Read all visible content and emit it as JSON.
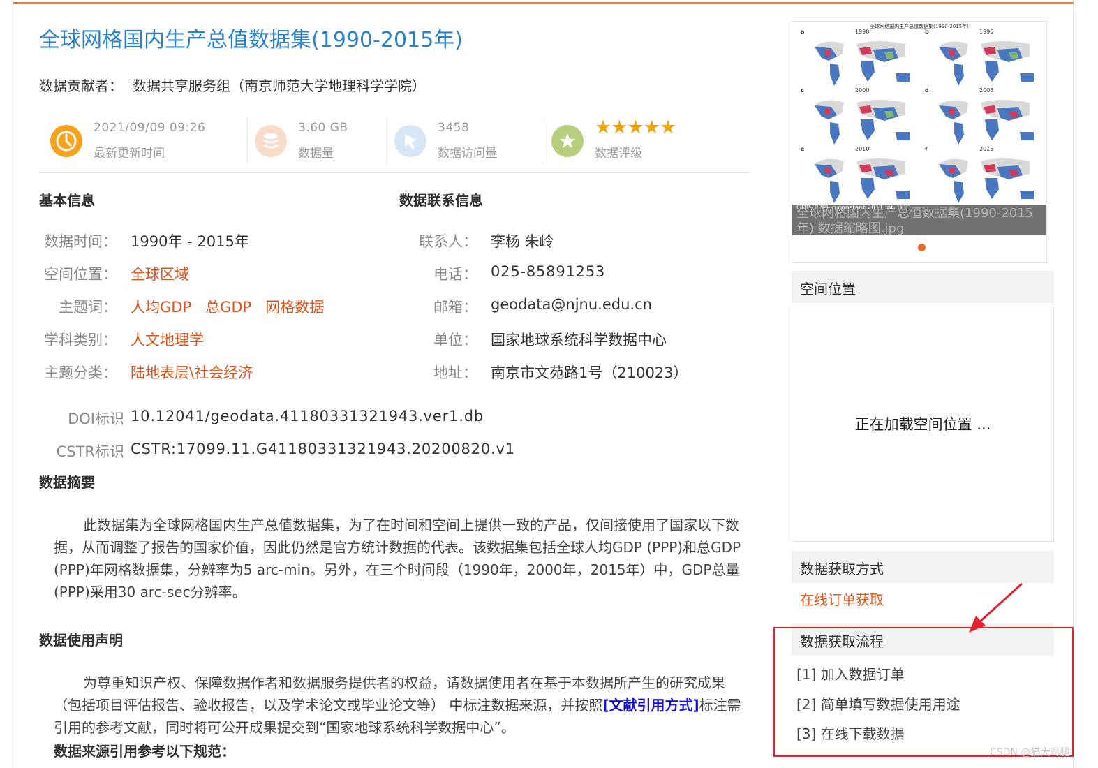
{
  "page": {
    "title": "全球网格国内生产总值数据集(1990-2015年)",
    "contributor_label": "数据贡献者：",
    "contributor_value": "数据共享服务组（南京师范大学地理科学学院）"
  },
  "stats": [
    {
      "value": "2021/09/09 09:26",
      "label": "最新更新时间",
      "icon": "clock-icon"
    },
    {
      "value": "3.60 GB",
      "label": "数据量",
      "icon": "database-icon"
    },
    {
      "value": "3458",
      "label": "数据访问量",
      "icon": "cursor-icon"
    },
    {
      "value": "★★★★★",
      "label": "数据评级",
      "icon": "star-badge-icon",
      "rating": 5
    }
  ],
  "basic_info": {
    "heading": "基本信息",
    "time_label": "数据时间：",
    "time_value": "1990年 - 2015年",
    "space_label": "空间位置：",
    "space_value": "全球区域",
    "keywords_label": "主题词：",
    "keywords": [
      "人均GDP",
      "总GDP",
      "网格数据"
    ],
    "discipline_label": "学科类别：",
    "discipline_value": "人文地理学",
    "category_label": "主题分类：",
    "category_value": "陆地表层\\社会经济",
    "doi_label": "DOI标识",
    "doi_value": "10.12041/geodata.41180331321943.ver1.db",
    "cstr_label": "CSTR标识",
    "cstr_value": "CSTR:17099.11.G41180331321943.20200820.v1"
  },
  "contact_info": {
    "heading": "数据联系信息",
    "person_label": "联系人：",
    "person_value": "李杨 朱岭",
    "phone_label": "电话：",
    "phone_value": "025-85891253",
    "email_label": "邮箱：",
    "email_value": "geodata@njnu.edu.cn",
    "org_label": "单位：",
    "org_value": "国家地球系统科学数据中心",
    "address_label": "地址：",
    "address_value": "南京市文苑路1号（210023）"
  },
  "abstract": {
    "heading": "数据摘要",
    "text": "此数据集为全球网格国内生产总值数据集，为了在时间和空间上提供一致的产品，仅间接使用了国家以下数据，从而调整了报告的国家价值，因此仍然是官方统计数据的代表。该数据集包括全球人均GDP (PPP)和总GDP (PPP)年网格数据集，分辨率为5 arc-min。另外，在三个时间段（1990年，2000年，2015年）中，GDP总量(PPP)采用30 arc-sec分辨率。"
  },
  "usage": {
    "heading": "数据使用声明",
    "text_before": "为尊重知识产权、保障数据作者和数据服务提供者的权益，请数据使用者在基于本数据所产生的研究成果（包括项目评估报告、验收报告，以及学术论文或毕业论文等） 中标注数据来源，并按照",
    "link": "[文献引用方式]",
    "text_after": "标注需引用的参考文献，同时将可公开成果提交到“国家地球系统科学数据中心”。",
    "citation_heading": "数据来源引用参考以下规范："
  },
  "thumbnail": {
    "figure_title": "全球网格国内生产总值数据集(1990-2015年)",
    "panels": [
      {
        "letter": "a",
        "year": "1990"
      },
      {
        "letter": "b",
        "year": "1995"
      },
      {
        "letter": "c",
        "year": "2000"
      },
      {
        "letter": "d",
        "year": "2005"
      },
      {
        "letter": "e",
        "year": "2010"
      },
      {
        "letter": "f",
        "year": "2015"
      }
    ],
    "legend_title": "GDP (PPP) in constant 2011 int. USD",
    "caption_overlay": "全球网格国内生产总值数据集(1990-2015年) 数据缩略图.jpg",
    "map_colors": {
      "land": "#4a78c0",
      "high": "#d13a5a",
      "mid": "#7fb86a",
      "none": "#d8d8d8"
    }
  },
  "sidebar": {
    "spatial_heading": "空间位置",
    "loading_text": "正在加载空间位置 ...",
    "access_heading": "数据获取方式",
    "access_link": "在线订单获取",
    "process_heading": "数据获取流程",
    "steps": [
      "[1] 加入数据订单",
      "[2] 简单填写数据使用用途",
      "[3] 在线下载数据"
    ]
  },
  "watermark": "CSDN @猫大鸡腿"
}
